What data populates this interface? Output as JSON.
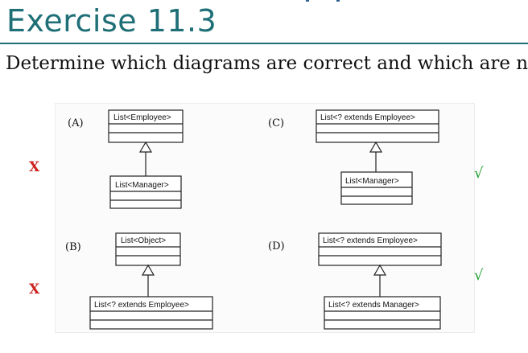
{
  "slide": {
    "title": "Exercise 11.3",
    "instruction": "Determine which diagrams are correct and which are not."
  },
  "diagrams": [
    {
      "label": "(A)",
      "super_class": "List<Employee>",
      "sub_class": "List<Manager>",
      "verdict": "X"
    },
    {
      "label": "(B)",
      "super_class": "List<Object>",
      "sub_class": "List<? extends Employee>",
      "verdict": "X"
    },
    {
      "label": "(C)",
      "super_class": "List<? extends Employee>",
      "sub_class": "List<Manager>",
      "verdict": "√"
    },
    {
      "label": "(D)",
      "super_class": "List<? extends Employee>",
      "sub_class": "List<? extends Manager>",
      "verdict": "√"
    }
  ],
  "colors": {
    "title": "#1f6f77",
    "wrong_mark": "#cc2222",
    "right_mark": "#1fa02f"
  }
}
